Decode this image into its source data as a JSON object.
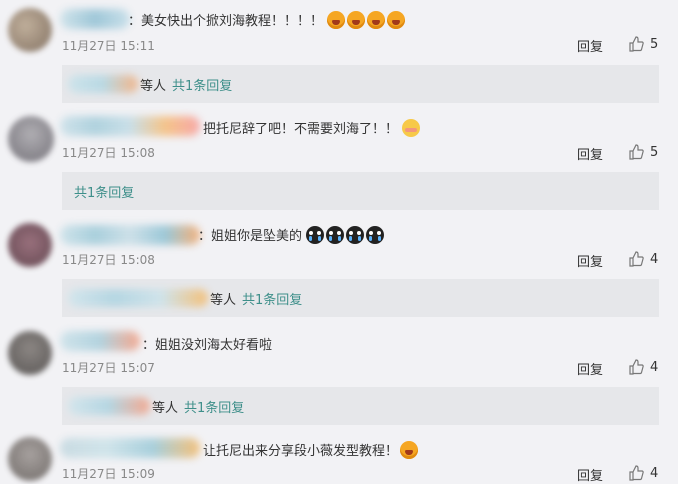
{
  "comments": [
    {
      "text": "：美女快出个掀刘海教程！！！！",
      "emojis": [
        "angry",
        "angry",
        "angry",
        "angry"
      ],
      "time": "11月27日 15:11",
      "reply": "回复",
      "likes": "5",
      "sub_who": "等人",
      "sub_count": "共1条回复"
    },
    {
      "text": "把托尼辞了吧！不需要刘海了！！",
      "emojis": [
        "shy"
      ],
      "time": "11月27日 15:08",
      "reply": "回复",
      "likes": "5",
      "sub_count": "共1条回复"
    },
    {
      "text": "：姐姐你是坠美的",
      "emojis": [
        "cry",
        "cry",
        "cry",
        "cry"
      ],
      "time": "11月27日 15:08",
      "reply": "回复",
      "likes": "4",
      "sub_who": "等人",
      "sub_count": "共1条回复"
    },
    {
      "text": "：姐姐没刘海太好看啦",
      "emojis": [],
      "time": "11月27日 15:07",
      "reply": "回复",
      "likes": "4",
      "sub_who": "等人",
      "sub_count": "共1条回复"
    },
    {
      "text": "让托尼出来分享段小薇发型教程！",
      "emojis": [
        "angry"
      ],
      "time": "11月27日 15:09",
      "reply": "回复",
      "likes": "4"
    }
  ],
  "colors": {
    "link": "#3e8f8a",
    "sub_bg": "#e6e7ea",
    "page_bg": "#f2f2f5"
  }
}
